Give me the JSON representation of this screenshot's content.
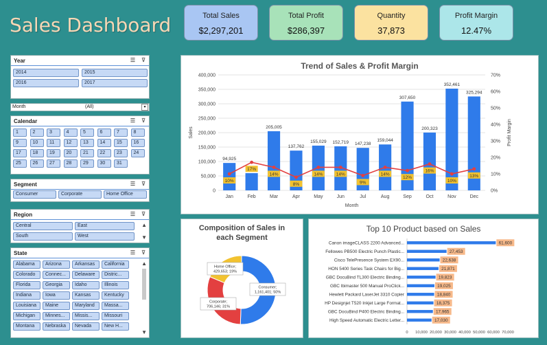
{
  "header": {
    "title": "Sales Dashboard"
  },
  "kpis": [
    {
      "label": "Total Sales",
      "value": "$2,297,201",
      "color": "#a9c6f3"
    },
    {
      "label": "Total Profit",
      "value": "$286,397",
      "color": "#a8e2b9"
    },
    {
      "label": "Quantity",
      "value": "37,873",
      "color": "#fbe2a0"
    },
    {
      "label": "Profit Margin",
      "value": "12.47%",
      "color": "#ace6e9"
    }
  ],
  "slicers": {
    "year": {
      "title": "Year",
      "items": [
        "2014",
        "2015",
        "2016",
        "2017"
      ]
    },
    "month": {
      "label": "Month",
      "value": "(All)"
    },
    "calendar": {
      "title": "Calendar",
      "items": [
        "1",
        "2",
        "3",
        "4",
        "5",
        "6",
        "7",
        "8",
        "9",
        "10",
        "11",
        "12",
        "13",
        "14",
        "15",
        "16",
        "17",
        "18",
        "19",
        "20",
        "21",
        "22",
        "23",
        "24",
        "25",
        "26",
        "27",
        "28",
        "29",
        "30",
        "31"
      ]
    },
    "segment": {
      "title": "Segment",
      "items": [
        "Consumer",
        "Corporate",
        "Home Office"
      ]
    },
    "region": {
      "title": "Region",
      "items": [
        "Central",
        "East",
        "South",
        "West"
      ]
    },
    "state": {
      "title": "State",
      "items": [
        "Alabama",
        "Arizona",
        "Arkansas",
        "California",
        "Colorado",
        "Connec...",
        "Delaware",
        "Distric...",
        "Florida",
        "Georgia",
        "Idaho",
        "Illinois",
        "Indiana",
        "Iowa",
        "Kansas",
        "Kentucky",
        "Louisiana",
        "Maine",
        "Maryland",
        "Massa...",
        "Michigan",
        "Minnes...",
        "Missis...",
        "Missouri",
        "Montana",
        "Nebraska",
        "Nevada",
        "New H..."
      ]
    }
  },
  "chart_data": [
    {
      "type": "bar",
      "title": "Trend of Sales & Profit Margin",
      "xlabel": "Month",
      "ylabel": "Sales",
      "y2label": "Profit Margin",
      "categories": [
        "Jan",
        "Feb",
        "Mar",
        "Apr",
        "May",
        "Jun",
        "Jul",
        "Aug",
        "Sep",
        "Oct",
        "Nov",
        "Dec"
      ],
      "ylim": [
        0,
        400000
      ],
      "yticks": [
        "0",
        "50,000",
        "100,000",
        "150,000",
        "200,000",
        "250,000",
        "300,000",
        "350,000",
        "400,000"
      ],
      "y2lim": [
        0,
        70
      ],
      "y2ticks": [
        "0%",
        "10%",
        "20%",
        "30%",
        "40%",
        "50%",
        "60%",
        "70%"
      ],
      "series": [
        {
          "name": "Sales",
          "values": [
            94925,
            59751,
            205005,
            137762,
            155029,
            152719,
            147238,
            159044,
            307650,
            200323,
            352461,
            325294
          ],
          "labels": [
            "94,925",
            "",
            "205,005",
            "137,762",
            "155,029",
            "152,719",
            "147,238",
            "159,044",
            "307,650",
            "200,323",
            "352,461",
            "325,294"
          ]
        },
        {
          "name": "Profit Margin",
          "values": [
            10,
            17,
            14,
            8,
            14,
            14,
            9,
            14,
            12,
            16,
            10,
            13
          ],
          "labels": [
            "10%",
            "17%",
            "14%",
            "8%",
            "14%",
            "14%",
            "9%",
            "14%",
            "12%",
            "16%",
            "10%",
            "13%"
          ]
        }
      ],
      "colors": {
        "bar": "#2f7bea",
        "line": "#e34040",
        "label_bg": "#f2c230"
      }
    },
    {
      "type": "pie",
      "title": [
        "Composition of Sales in",
        "each Segment"
      ],
      "categories": [
        "Consumer",
        "Corporate",
        "Home Office"
      ],
      "values": [
        1161401,
        706146,
        429653
      ],
      "labels": [
        "Consumer;\n1,161,401; 50%",
        "Corporate;\n706,146; 31%",
        "Home Office;\n429,653; 19%"
      ],
      "colors": [
        "#2f7bea",
        "#e34040",
        "#f2c230"
      ]
    },
    {
      "type": "bar",
      "title": "Top 10 Product based on Sales",
      "categories": [
        "Canon imageCLASS 2200 Advanced...",
        "Fellowes PB500 Electric Punch Plastic...",
        "Cisco TelePresence System EX90...",
        "HON 5400 Series Task Chairs for Big...",
        "GBC DocuBind TL300 Electric Binding...",
        "GBC Ibimaster 500 Manual ProClick...",
        "Hewlett Packard LaserJet 3310 Copier",
        "HP Designjet T520 Inkjet Large Format...",
        "GBC DocuBind P400 Electric Binding...",
        "High Speed Automatic Electric Letter..."
      ],
      "values": [
        61600,
        27453,
        22638,
        21871,
        19823,
        19025,
        18840,
        18375,
        17965,
        17030
      ],
      "labels": [
        "61,600",
        "27,453",
        "22,638",
        "21,871",
        "19,823",
        "19,025",
        "18,840",
        "18,375",
        "17,965",
        "17,030"
      ],
      "xlim": [
        0,
        70000
      ],
      "xticks": [
        "0",
        "10,000",
        "20,000",
        "30,000",
        "40,000",
        "50,000",
        "60,000",
        "70,000"
      ],
      "colors": {
        "bar": "#2f7bea",
        "label_bg": "#f7b98a"
      }
    }
  ]
}
